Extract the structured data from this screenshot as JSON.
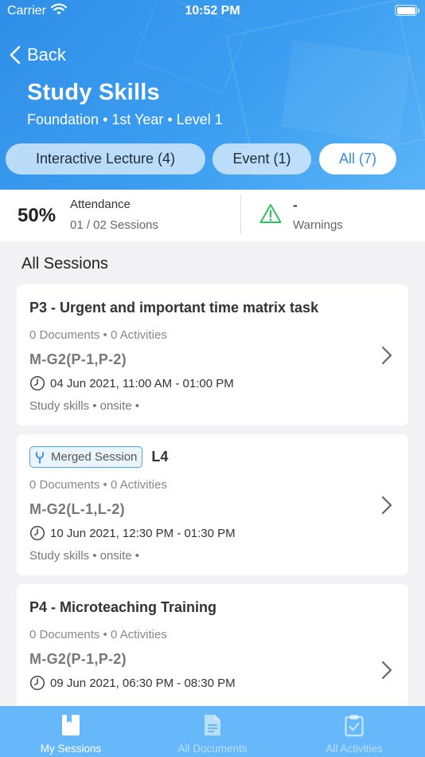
{
  "status_bar": {
    "carrier": "Carrier",
    "time": "10:52 PM"
  },
  "nav": {
    "back_label": "Back"
  },
  "course": {
    "title": "Study Skills",
    "subtitle": "Foundation • 1st Year • Level 1"
  },
  "filters": [
    {
      "label": "Interactive Lecture (4)",
      "selected": false
    },
    {
      "label": "Event (1)",
      "selected": false
    },
    {
      "label": "All (7)",
      "selected": true
    }
  ],
  "stats": {
    "attendance_percent": "50%",
    "attendance_label": "Attendance",
    "attendance_sessions": "01 / 02 Sessions",
    "warnings_value": "-",
    "warnings_label": "Warnings"
  },
  "section_title": "All Sessions",
  "sessions": [
    {
      "title": "P3 - Urgent and important time matrix task",
      "meta": "0 Documents • 0 Activities",
      "group": "M-G2(P-1,P-2)",
      "time": "04 Jun 2021, 11:00 AM - 01:00 PM",
      "tags": "Study skills • onsite •"
    },
    {
      "badge": "Merged Session",
      "code": "L4",
      "meta": "0 Documents • 0 Activities",
      "group": "M-G2(L-1,L-2)",
      "time": "10 Jun 2021, 12:30 PM - 01:30 PM",
      "tags": "Study skills • onsite •"
    },
    {
      "title": "P4 - Microteaching Training",
      "meta": "0 Documents • 0 Activities",
      "group": "M-G2(P-1,P-2)",
      "time": "09 Jun 2021, 06:30 PM - 08:30 PM"
    }
  ],
  "tabs": [
    {
      "label": "My Sessions",
      "icon": "book-icon",
      "active": true
    },
    {
      "label": "All Documents",
      "icon": "document-icon",
      "active": false
    },
    {
      "label": "All Activities",
      "icon": "clipboard-check-icon",
      "active": false
    }
  ],
  "colors": {
    "header_gradient_start": "#2f8fe8",
    "header_gradient_end": "#5ab4f7",
    "accent": "#2f8fe8",
    "warning_green": "#2fc25b",
    "tabbar": "#67b8fb"
  }
}
